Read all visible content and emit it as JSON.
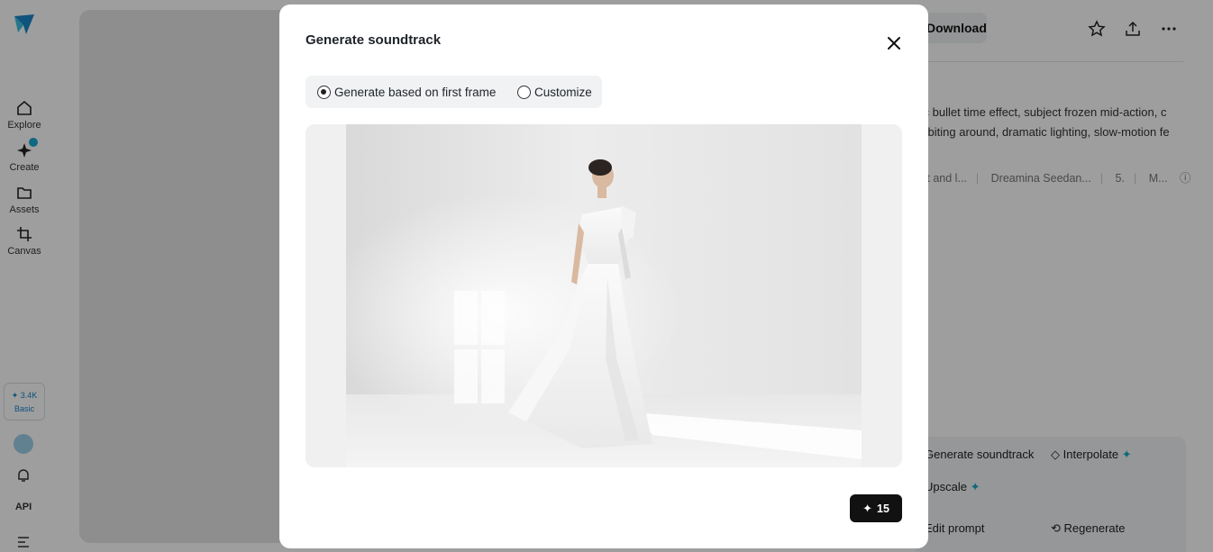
{
  "sidebar": {
    "items": [
      {
        "label": "Explore",
        "icon": "home-icon"
      },
      {
        "label": "Create",
        "icon": "sparkle-icon"
      },
      {
        "label": "Assets",
        "icon": "folder-icon"
      },
      {
        "label": "Canvas",
        "icon": "crop-icon"
      }
    ],
    "credits_value": "3.4K",
    "credits_plan": "Basic",
    "api_label": "API"
  },
  "topbar": {
    "download_label": "Download"
  },
  "details": {
    "prompt_line1": "tic bullet time effect, subject frozen mid-action, c",
    "prompt_line2": "orbiting around, dramatic lighting, slow-motion fe",
    "meta": [
      "rst and l...",
      "Dreamina Seedan...",
      "5.",
      "M..."
    ],
    "actions": {
      "generate_soundtrack": "Generate soundtrack",
      "interpolate": "Interpolate",
      "upscale": "Upscale",
      "edit_prompt": "Edit prompt",
      "regenerate": "Regenerate"
    }
  },
  "modal": {
    "title": "Generate soundtrack",
    "options": [
      {
        "label": "Generate based on first frame",
        "selected": true
      },
      {
        "label": "Customize",
        "selected": false
      }
    ],
    "cost": "15"
  },
  "colors": {
    "accent": "#17a9c6",
    "button_dark": "#111111"
  }
}
